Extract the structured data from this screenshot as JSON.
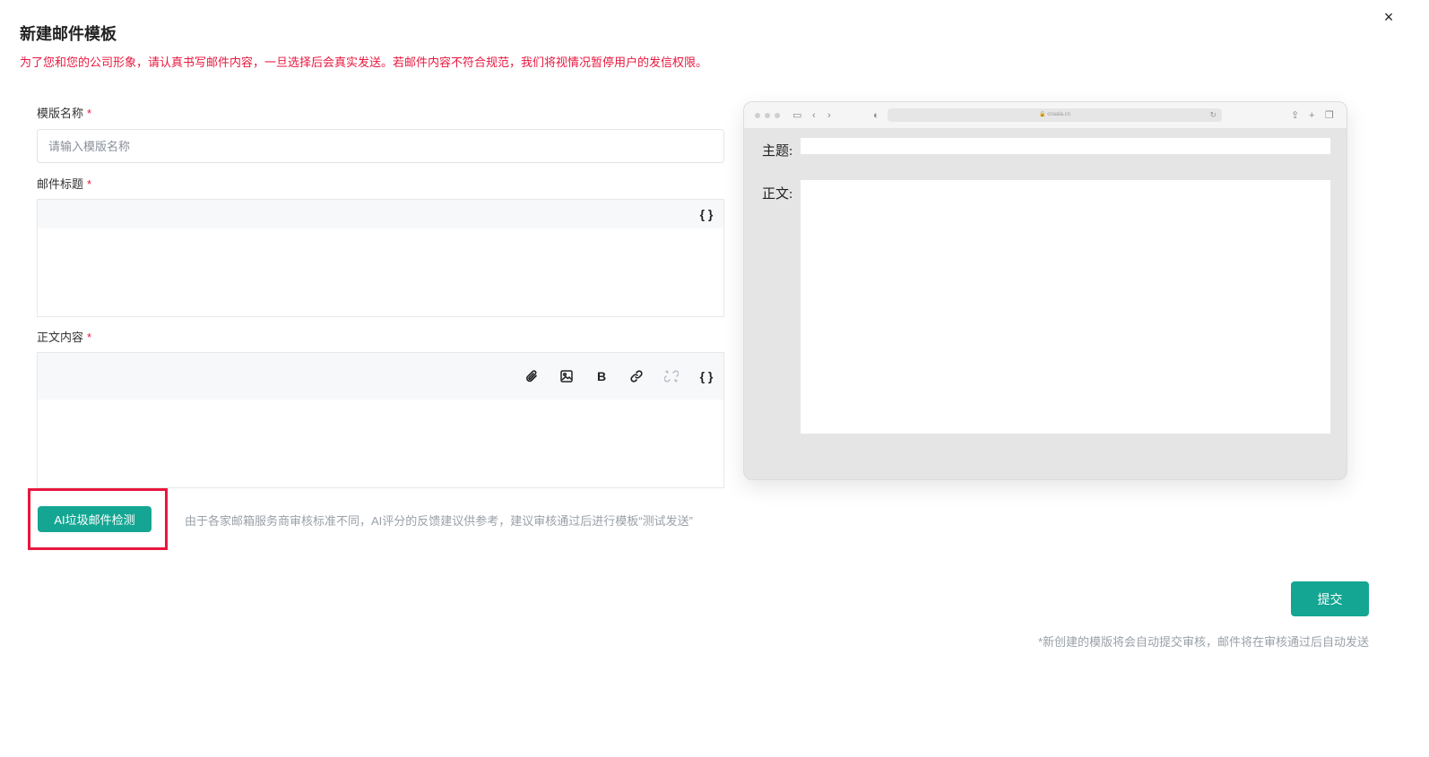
{
  "dialog": {
    "title": "新建邮件模板",
    "close_symbol": "×",
    "warning": "为了您和您的公司形象，请认真书写邮件内容，一旦选择后会真实发送。若邮件内容不符合规范，我们将视情况暂停用户的发信权限。"
  },
  "form": {
    "required_mark": "*",
    "name_label": "模版名称",
    "name_placeholder": "请输入模版名称",
    "subject_label": "邮件标题",
    "body_label": "正文内容",
    "variable_symbol": "{ }",
    "bold_symbol": "B"
  },
  "ai": {
    "button_label": "AI垃圾邮件检测",
    "hint": "由于各家邮箱服务商审核标准不同，AI评分的反馈建议供参考，建议审核通过后进行模板“测试发送”"
  },
  "preview": {
    "url": "🔒 cnaala.cn",
    "subject_label": "主题:",
    "body_label": "正文:"
  },
  "footer": {
    "submit_label": "提交",
    "note": "*新创建的模版将会自动提交审核，邮件将在审核通过后自动发送"
  },
  "colors": {
    "accent": "#14a693",
    "warning": "#e8173f",
    "highlight_border": "#e8173f"
  },
  "icons": [
    "close-icon",
    "attachment-icon",
    "image-icon",
    "bold-icon",
    "link-icon",
    "unlink-icon",
    "variable-icon"
  ]
}
